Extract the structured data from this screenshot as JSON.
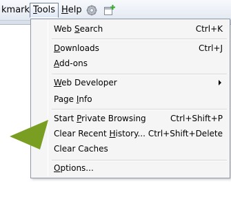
{
  "menubar": {
    "bookmarks_partial": "kmarks",
    "tools": {
      "pre": "",
      "key": "T",
      "post": "ools"
    },
    "help": {
      "pre": "",
      "key": "H",
      "post": "elp"
    }
  },
  "icons": {
    "settings": "gear-icon",
    "add": "add-tab-icon",
    "pointer": "green-arrow-icon"
  },
  "colors": {
    "accent_arrow": "#7a9e21",
    "menu_bg": "#f5f5f5",
    "menu_border": "#8f98a5"
  },
  "menu": {
    "web_search": {
      "pre": "Web ",
      "key": "S",
      "post": "earch",
      "shortcut": "Ctrl+K"
    },
    "downloads": {
      "pre": "",
      "key": "D",
      "post": "ownloads",
      "shortcut": "Ctrl+J"
    },
    "addons": {
      "pre": "",
      "key": "A",
      "post": "dd-ons"
    },
    "web_developer": {
      "pre": "",
      "key": "W",
      "post": "eb Developer"
    },
    "page_info": {
      "pre": "Page ",
      "key": "I",
      "post": "nfo"
    },
    "private_browsing": {
      "pre": "Start ",
      "key": "P",
      "post": "rivate Browsing",
      "shortcut": "Ctrl+Shift+P"
    },
    "clear_history": {
      "pre": "Clear Recent ",
      "key": "H",
      "post": "istory...",
      "shortcut": "Ctrl+Shift+Delete"
    },
    "clear_caches": {
      "label": "Clear Caches"
    },
    "options": {
      "pre": "",
      "key": "O",
      "post": "ptions..."
    }
  }
}
